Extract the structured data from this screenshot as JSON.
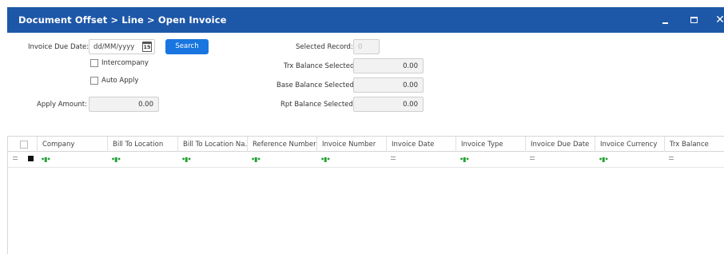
{
  "window": {
    "title": "Document Offset > Line > Open Invoice",
    "icons": {
      "minimize": "minimize-icon",
      "maximize": "maximize-icon",
      "close": "close-icon"
    }
  },
  "form": {
    "invoice_due_date": {
      "label": "Invoice Due Date:",
      "placeholder": "dd/MM/yyyy",
      "calendar_day": "15"
    },
    "search_label": "Search",
    "intercompany": {
      "label": "Intercompany",
      "checked": false
    },
    "auto_apply": {
      "label": "Auto Apply",
      "checked": false
    },
    "apply_amount": {
      "label": "Apply Amount:",
      "value": "0.00"
    },
    "selected_record": {
      "label": "Selected Record:",
      "value": "0"
    },
    "trx_balance_selected": {
      "label": "Trx Balance Selected:",
      "value": "0.00"
    },
    "base_balance_selected": {
      "label": "Base Balance Selected:",
      "value": "0.00"
    },
    "rpt_balance_selected": {
      "label": "Rpt Balance Selected:",
      "value": "0.00"
    }
  },
  "grid": {
    "columns": [
      {
        "label": "Company",
        "filter": "contains"
      },
      {
        "label": "Bill To Location",
        "filter": "contains"
      },
      {
        "label": "Bill To Location Na...",
        "filter": "contains"
      },
      {
        "label": "Reference Number",
        "filter": "contains"
      },
      {
        "label": "Invoice Number",
        "filter": "contains"
      },
      {
        "label": "Invoice Date",
        "filter": "equals"
      },
      {
        "label": "Invoice Type",
        "filter": "contains"
      },
      {
        "label": "Invoice Due Date",
        "filter": "equals"
      },
      {
        "label": "Invoice Currency",
        "filter": "contains"
      },
      {
        "label": "Trx Balance",
        "filter": "equals"
      }
    ],
    "rows": []
  },
  "colors": {
    "titlebar": "#1d57a8",
    "search_button": "#1976e0",
    "filter_contains": "#22a033"
  }
}
